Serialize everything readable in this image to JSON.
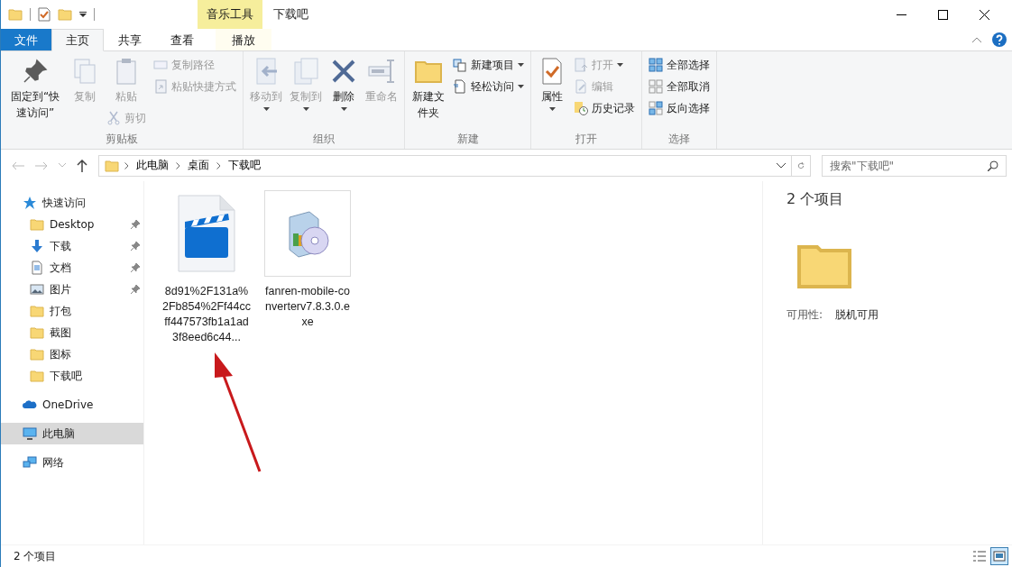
{
  "title_bar": {
    "title": "下载吧",
    "context_group": "音乐工具"
  },
  "ribbon_tabs": [
    {
      "label": "文件",
      "kind": "file",
      "selected": false
    },
    {
      "label": "主页",
      "kind": "tab",
      "selected": true
    },
    {
      "label": "共享",
      "kind": "tab",
      "selected": false
    },
    {
      "label": "查看",
      "kind": "tab",
      "selected": false
    },
    {
      "label": "播放",
      "kind": "context",
      "selected": false
    }
  ],
  "ribbon_groups": [
    {
      "label": "剪贴板",
      "columns": [
        [
          {
            "label": "固定到“快速访问”",
            "kind": "large",
            "disabled": false,
            "dropdown": false
          }
        ],
        [
          {
            "label": "复制",
            "kind": "large",
            "disabled": true,
            "dropdown": false
          }
        ],
        [
          {
            "label": "粘贴",
            "kind": "large",
            "disabled": true,
            "dropdown": false
          },
          {
            "label": "剪切",
            "kind": "small",
            "disabled": true,
            "dropdown": false
          }
        ],
        [
          {
            "label": "复制路径",
            "kind": "small",
            "disabled": true,
            "dropdown": false
          },
          {
            "label": "粘贴快捷方式",
            "kind": "small",
            "disabled": true,
            "dropdown": false
          }
        ]
      ]
    },
    {
      "label": "组织",
      "columns": [
        [
          {
            "label": "移动到",
            "kind": "large",
            "disabled": true,
            "dropdown": true
          }
        ],
        [
          {
            "label": "复制到",
            "kind": "large",
            "disabled": true,
            "dropdown": true
          }
        ],
        [
          {
            "label": "删除",
            "kind": "large",
            "disabled": false,
            "dropdown": true
          }
        ],
        [
          {
            "label": "重命名",
            "kind": "large",
            "disabled": true,
            "dropdown": false
          }
        ]
      ]
    },
    {
      "label": "新建",
      "columns": [
        [
          {
            "label": "新建文件夹",
            "kind": "large",
            "disabled": false,
            "dropdown": false
          }
        ],
        [
          {
            "label": "新建项目",
            "kind": "small",
            "disabled": false,
            "dropdown": true
          },
          {
            "label": "轻松访问",
            "kind": "small",
            "disabled": false,
            "dropdown": true
          }
        ]
      ]
    },
    {
      "label": "打开",
      "columns": [
        [
          {
            "label": "属性",
            "kind": "large",
            "disabled": false,
            "dropdown": true
          }
        ],
        [
          {
            "label": "打开",
            "kind": "small",
            "disabled": true,
            "dropdown": true
          },
          {
            "label": "编辑",
            "kind": "small",
            "disabled": true,
            "dropdown": false
          },
          {
            "label": "历史记录",
            "kind": "small",
            "disabled": false,
            "dropdown": false
          }
        ]
      ]
    },
    {
      "label": "选择",
      "columns": [
        [
          {
            "label": "全部选择",
            "kind": "small",
            "disabled": false,
            "dropdown": false
          },
          {
            "label": "全部取消",
            "kind": "small",
            "disabled": false,
            "dropdown": false
          },
          {
            "label": "反向选择",
            "kind": "small",
            "disabled": false,
            "dropdown": false
          }
        ]
      ]
    }
  ],
  "address_bar": {
    "breadcrumbs": [
      "此电脑",
      "桌面",
      "下载吧"
    ],
    "search_placeholder": "搜索\"下载吧\""
  },
  "sidebar": [
    {
      "label": "快速访问",
      "kind": "star",
      "selected": false,
      "children": [
        {
          "label": "Desktop",
          "kind": "folder",
          "pinned": true,
          "selected": false
        },
        {
          "label": "下载",
          "kind": "download",
          "pinned": true,
          "selected": false
        },
        {
          "label": "文档",
          "kind": "document",
          "pinned": true,
          "selected": false
        },
        {
          "label": "图片",
          "kind": "pictures",
          "pinned": true,
          "selected": false
        },
        {
          "label": "打包",
          "kind": "folder",
          "pinned": false,
          "selected": false
        },
        {
          "label": "截图",
          "kind": "folder",
          "pinned": false,
          "selected": false
        },
        {
          "label": "图标",
          "kind": "folder",
          "pinned": false,
          "selected": false
        },
        {
          "label": "下载吧",
          "kind": "folder",
          "pinned": false,
          "selected": false
        }
      ]
    },
    {
      "label": "OneDrive",
      "kind": "cloud",
      "selected": false
    },
    {
      "label": "此电脑",
      "kind": "computer",
      "selected": true
    },
    {
      "label": "网络",
      "kind": "network",
      "selected": false
    }
  ],
  "files": [
    {
      "name": "8d91%2F131a%2Fb854%2Ff44ccff447573fb1a1ad3f8eed6c44...",
      "kind": "video",
      "focused": false
    },
    {
      "name": "fanren-mobile-converterv7.8.3.0.exe",
      "kind": "installer",
      "focused": true
    }
  ],
  "details_pane": {
    "title": "2 个项目",
    "property_label": "可用性:",
    "property_value": "脱机可用"
  },
  "status_bar": {
    "text": "2 个项目",
    "views": [
      {
        "kind": "details",
        "selected": false
      },
      {
        "kind": "large_icons",
        "selected": true
      }
    ]
  }
}
